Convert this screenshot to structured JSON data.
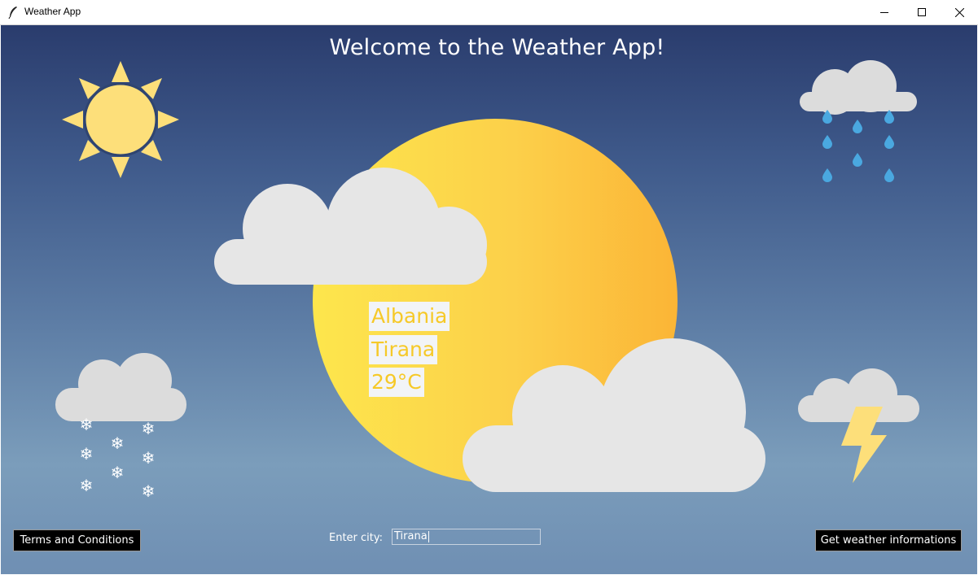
{
  "window": {
    "title": "Weather App",
    "controls": [
      "minimize-icon",
      "maximize-icon",
      "close-icon"
    ]
  },
  "header": {
    "title": "Welcome to the Weather App!"
  },
  "weather": {
    "country": "Albania",
    "city": "Tirana",
    "temperature": "29°C"
  },
  "footer": {
    "terms_label": "Terms and Conditions",
    "enter_city_label": "Enter city:",
    "city_input_value": "Tirana",
    "get_weather_label": "Get weather informations"
  },
  "icons": [
    "sun-icon",
    "rain-cloud-icon",
    "snow-cloud-icon",
    "thunder-cloud-icon",
    "sun-behind-clouds-icon"
  ],
  "colors": {
    "sky_top": "#2a3c6d",
    "sky_bottom": "#7b9dbb",
    "sun": "#fcd84f",
    "cloud": "#e6e6e6",
    "label_text": "#f6c928",
    "rain": "#4aa8e0",
    "button_bg": "#000000"
  }
}
